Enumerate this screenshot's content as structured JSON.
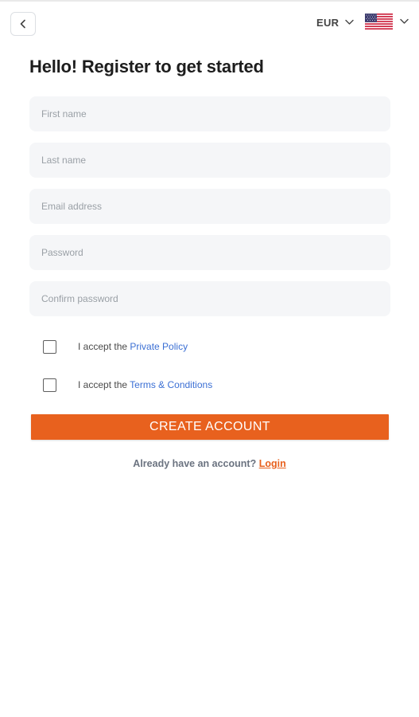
{
  "header": {
    "back_icon": "chevron-left-icon",
    "currency": "EUR",
    "currency_icon": "chevron-down-icon",
    "language_flag": "us-flag-icon",
    "language_icon": "chevron-down-icon"
  },
  "form": {
    "title": "Hello! Register to get started",
    "fields": {
      "first_name": "First name",
      "last_name": "Last name",
      "email": "Email address",
      "password": "Password",
      "confirm_password": "Confirm password"
    },
    "privacy": {
      "prefix": "I accept the ",
      "link": "Private Policy"
    },
    "terms": {
      "prefix": "I accept the ",
      "link": "Terms & Conditions"
    },
    "submit_label": "CREATE ACCOUNT"
  },
  "footer": {
    "prompt": "Already have an account? ",
    "login_link": "Login"
  },
  "colors": {
    "accent": "#e8611e",
    "link": "#3b6fd4",
    "field_bg": "#f5f6f8"
  }
}
